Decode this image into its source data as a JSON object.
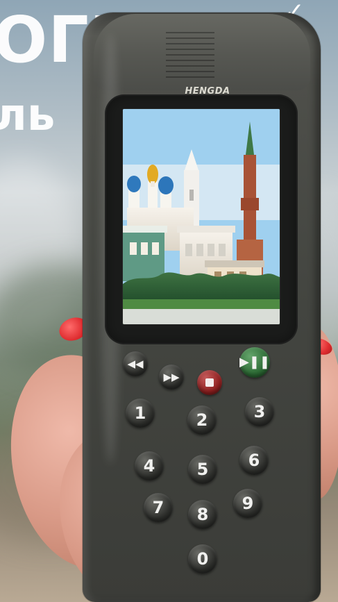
{
  "overlay": {
    "headline": "ОГИД",
    "subheadline": "ль"
  },
  "device": {
    "brand": "HENGDA",
    "keys": [
      "1",
      "2",
      "3",
      "4",
      "5",
      "6",
      "7",
      "8",
      "9",
      "0"
    ]
  },
  "colors": {
    "checkmark_white": "#ffffff",
    "checkmark_gold": "#ffd400",
    "device_body": "#4e4f4a",
    "play_button": "#2c6a34",
    "stop_button": "#8f1f1f"
  },
  "icons": {
    "rewind_button": "rewind-icon",
    "fast_forward_button": "fast-forward-icon",
    "stop_button": "stop-icon",
    "play_pause_button": "play-pause-icon",
    "checkmarks": [
      "checkmark-icon",
      "checkmark-icon",
      "checkmark-icon",
      "checkmark-icon"
    ]
  }
}
